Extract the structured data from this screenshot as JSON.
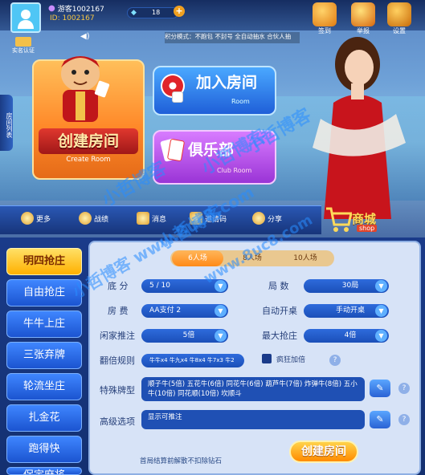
{
  "player": {
    "name": "游客1002167",
    "id": "ID: 1002167",
    "diamonds": "18"
  },
  "top_actions": [
    {
      "label": "签到",
      "icon": "gift-box-icon"
    },
    {
      "label": "举报",
      "icon": "report-icon"
    },
    {
      "label": "设置",
      "icon": "gear-icon"
    }
  ],
  "notice": "积分模式：不跑包 不封号 全自动抽水 合伙人抽",
  "auth_badge": "实名认证",
  "side_tab": "房间列表",
  "cards": {
    "create": {
      "title": "创建房间",
      "sub": "Create Room"
    },
    "join": {
      "title": "加入房间",
      "sub": "Room"
    },
    "club": {
      "title": "俱乐部",
      "sub": "Club Room"
    }
  },
  "nav": [
    {
      "label": "更多",
      "icon": "more-icon"
    },
    {
      "label": "战绩",
      "icon": "trophy-icon"
    },
    {
      "label": "消息",
      "icon": "mail-icon"
    },
    {
      "label": "邀请码",
      "icon": "gift-icon"
    },
    {
      "label": "分享",
      "icon": "share-icon"
    }
  ],
  "shop": {
    "label": "商城",
    "sub": "shop"
  },
  "modes": [
    "明四抢庄",
    "自由抢庄",
    "牛牛上庄",
    "三张弃牌",
    "轮流坐庄",
    "扎金花",
    "跑得快",
    "保定麻将"
  ],
  "player_tabs": [
    "6人场",
    "8人场",
    "10人场"
  ],
  "form": {
    "base_score": {
      "label": "底 分",
      "value": "5 / 10"
    },
    "rounds": {
      "label": "局 数",
      "value": "30局"
    },
    "room_fee": {
      "label": "房 费",
      "value": "AA支付 2"
    },
    "auto_start": {
      "label": "自动开桌",
      "value": "手动开桌"
    },
    "idle_push": {
      "label": "闲家推注",
      "value": "5倍"
    },
    "max_bid": {
      "label": "最大抢庄",
      "value": "4倍"
    },
    "double_rule": {
      "label": "翻倍规则",
      "value": "牛牛x4 牛九x4 牛8x4 牛7x3 牛2"
    },
    "crazy_double": "疯狂加倍",
    "special_cards": {
      "label": "特殊牌型",
      "value": "顺子牛(5倍) 五花牛(6倍) 同花牛(6倍) 葫芦牛(7倍) 炸弹牛(8倍) 五小牛(10倍) 同花顺(10倍) 坎顺斗"
    },
    "advanced": {
      "label": "高级选项",
      "value": "显示可推注"
    }
  },
  "footnote": "首局结算前解散不扣除钻石",
  "create_button": "创建房间",
  "watermarks": [
    "小哲博客",
    "小哲博客",
    "小哲博客",
    "www.8uc8.com",
    "小哲博客 www.8uc8.com",
    "小哲博客"
  ]
}
